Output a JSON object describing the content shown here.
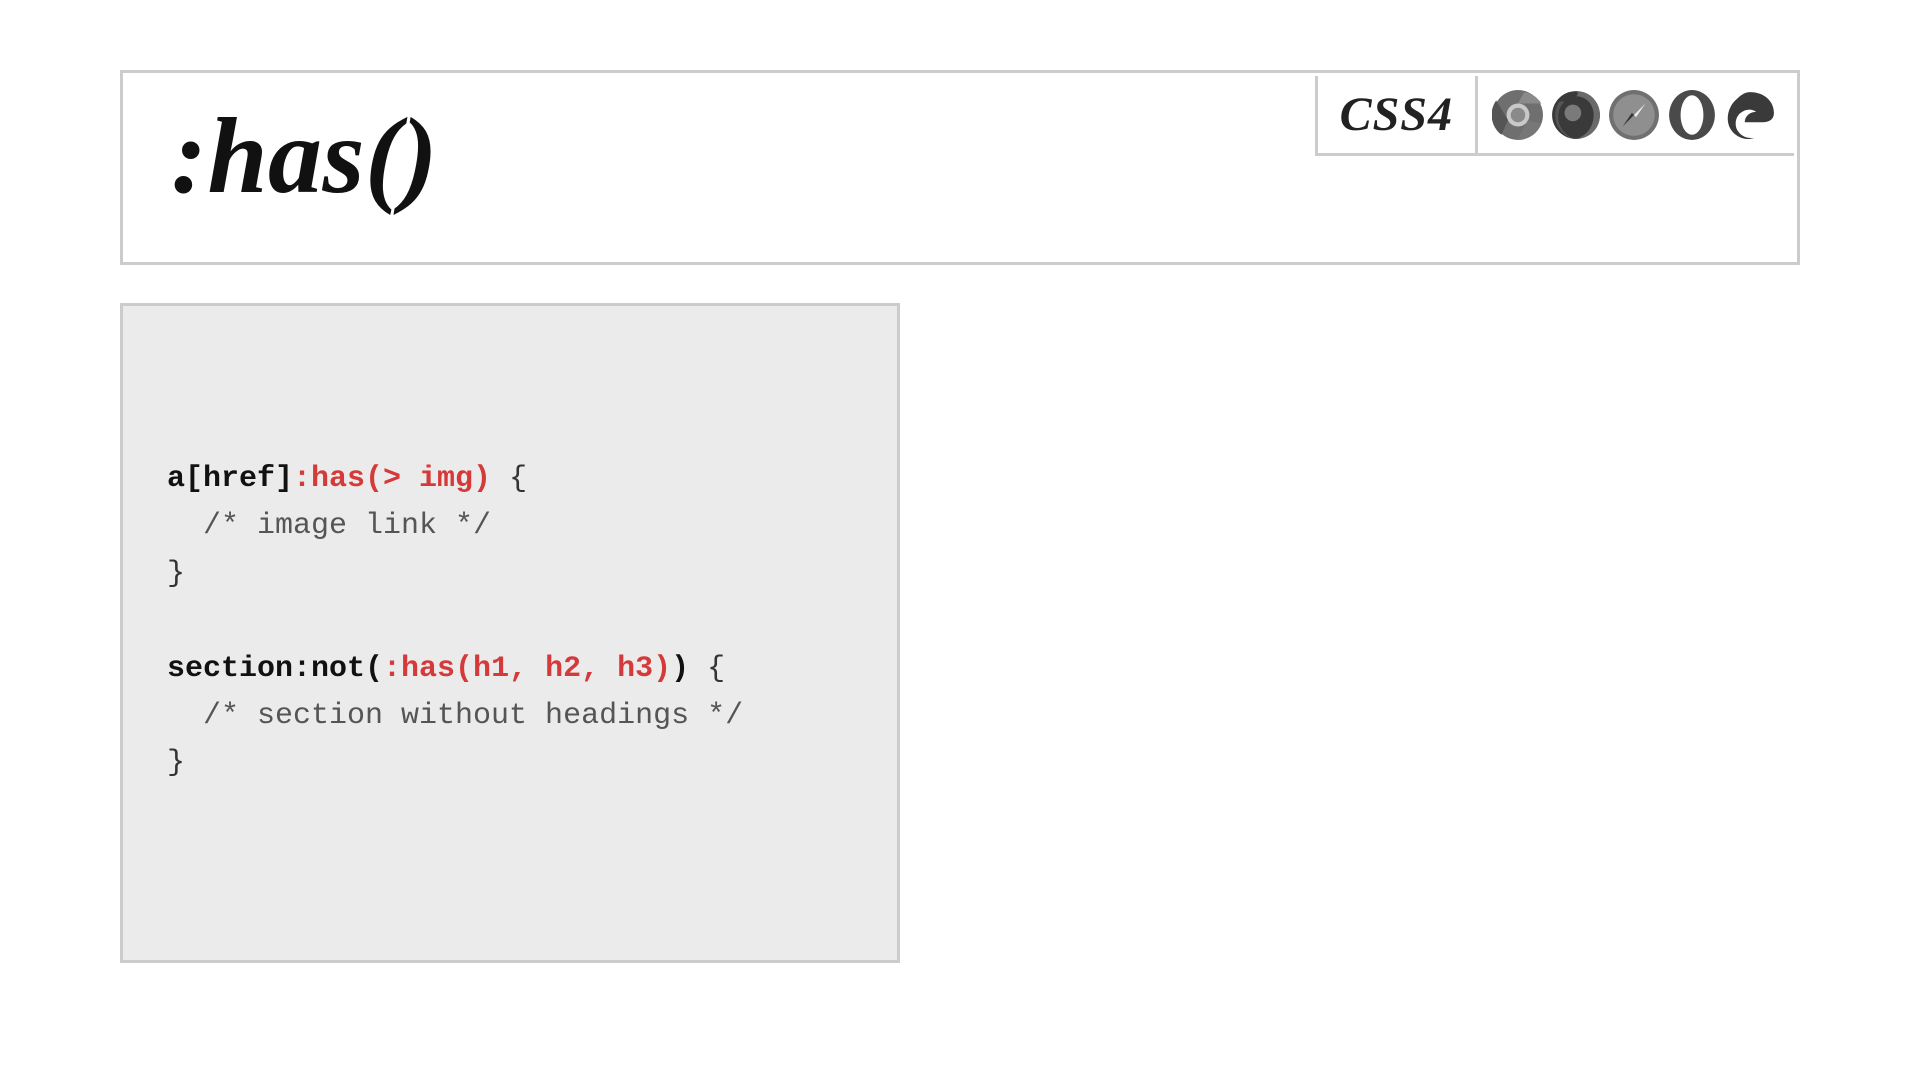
{
  "header": {
    "title": ":has()",
    "spec_label": "CSS4",
    "browsers": [
      "chrome",
      "firefox",
      "safari",
      "opera",
      "edge"
    ]
  },
  "code": {
    "line1_a": "a[href]",
    "line1_b": ":has(> img)",
    "line1_c": " {",
    "line2": "  /* image link */",
    "line3": "}",
    "blank": "",
    "line4_a": "section",
    "line4_b": ":not(",
    "line4_c": ":has(h1, h2, h3)",
    "line4_d": ")",
    "line4_e": " {",
    "line5": "  /* section without headings */",
    "line6": "}"
  }
}
